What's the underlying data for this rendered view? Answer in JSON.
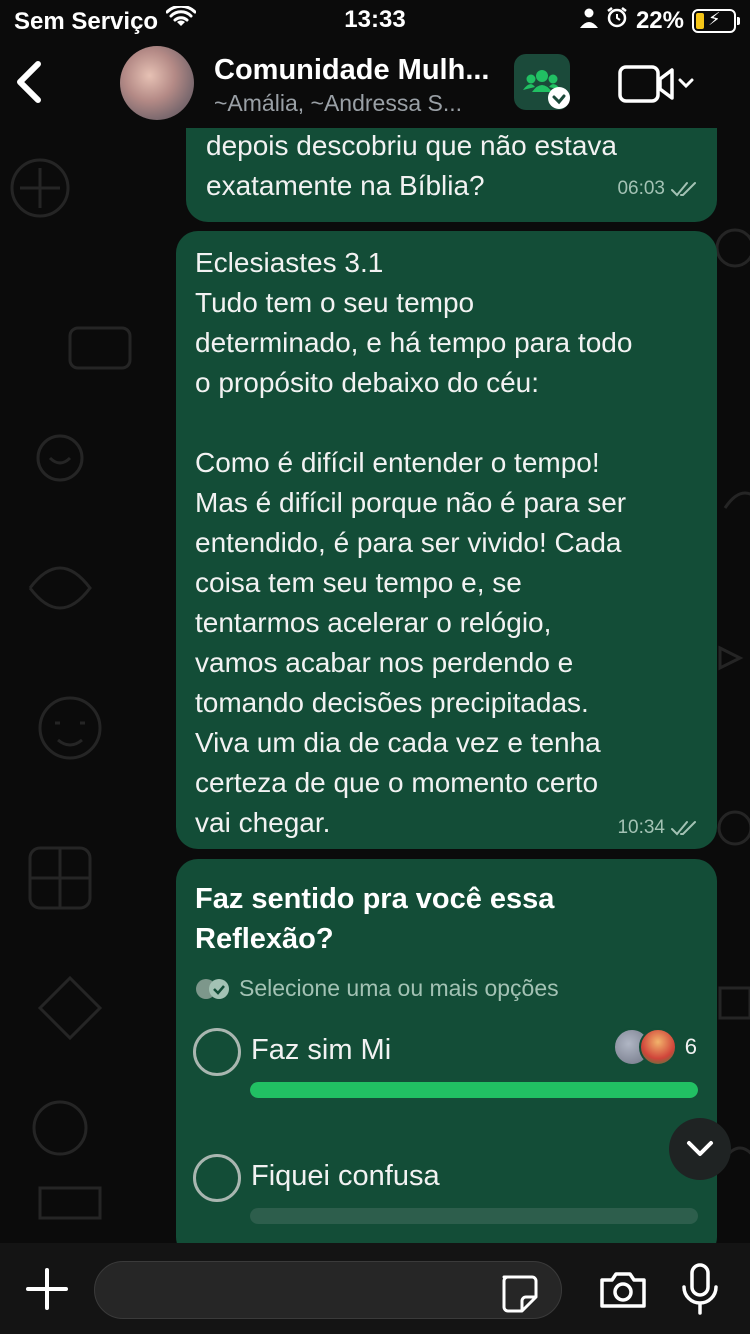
{
  "status_bar": {
    "carrier": "Sem Serviço",
    "time": "13:33",
    "battery": "22%",
    "battery_level": 0.22,
    "icons": [
      "wifi-icon",
      "person-icon",
      "alarm-icon",
      "battery-charging-icon"
    ]
  },
  "header": {
    "title": "Comunidade Mulh...",
    "subtitle": "~Amália, ~Andressa S...",
    "icons": [
      "back-chevron-icon",
      "community-icon",
      "video-call-icon",
      "chevron-down-icon"
    ]
  },
  "messages": [
    {
      "text": "depois descobriu que não estava\nexatamente na Bíblia?",
      "time": "06:03",
      "status_icon": "double-check-icon"
    },
    {
      "text": "Eclesiastes 3.1\nTudo tem o seu tempo\ndeterminado, e há tempo para todo\no propósito debaixo do céu:\n\nComo é difícil entender o tempo!\nMas é difícil porque não é para ser\nentendido, é para ser vivido! Cada\ncoisa tem seu tempo e, se\ntentarmos acelerar o relógio,\nvamos acabar nos perdendo e\ntomando decisões precipitadas.\nViva um dia de cada vez e tenha\ncerteza de que o momento certo\nvai chegar.",
      "time": "10:34",
      "status_icon": "double-check-icon"
    }
  ],
  "poll": {
    "question": "Faz sentido pra você essa\nReflexão?",
    "hint": "Selecione uma ou mais opções",
    "options": [
      {
        "label": "Faz sim Mi",
        "votes": "6",
        "share": 1.0
      },
      {
        "label": "Fiquei confusa",
        "votes": "",
        "share": 0.0
      }
    ]
  },
  "composer": {
    "placeholder": "",
    "icons": [
      "plus-icon",
      "sticker-icon",
      "camera-icon",
      "microphone-icon"
    ]
  },
  "colors": {
    "bubble": "#134d37",
    "poll_fill": "#21c063",
    "background": "#0b0b0b"
  }
}
